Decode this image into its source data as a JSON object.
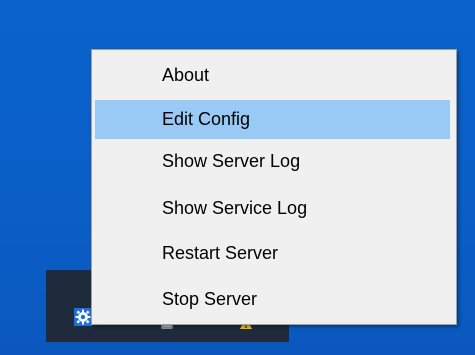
{
  "context_menu": {
    "items": [
      {
        "label": "About",
        "highlighted": false
      },
      {
        "label": "Edit Config",
        "highlighted": true
      },
      {
        "label": "Show Server Log",
        "highlighted": false
      },
      {
        "label": "Show Service Log",
        "highlighted": false
      },
      {
        "label": "Restart Server",
        "highlighted": false
      },
      {
        "label": "Stop Server",
        "highlighted": false
      }
    ]
  },
  "colors": {
    "desktop_background": "#0a5fc9",
    "menu_background": "#f0f0f0",
    "highlight": "#99c9f5",
    "tray_flyout": "#1e2b3d"
  },
  "tray": {
    "icons": [
      "gear-icon",
      "grey-tray-icon",
      "warning-icon"
    ]
  }
}
